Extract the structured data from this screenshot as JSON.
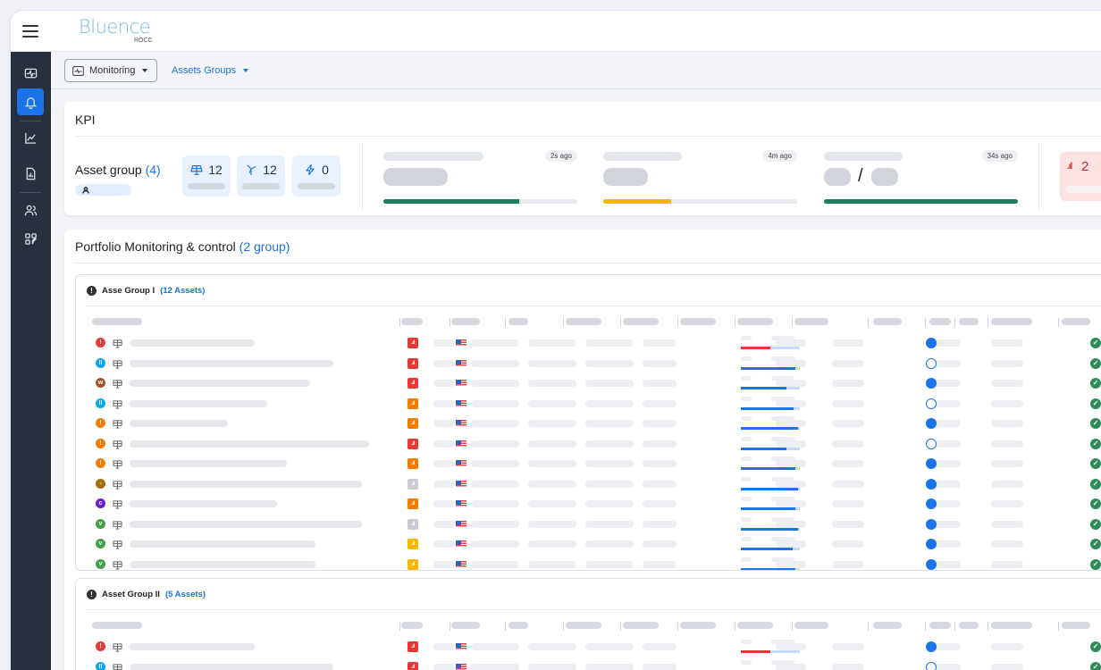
{
  "app": {
    "logo_text": "Bluence",
    "logo_sub": "ROCC"
  },
  "subheader": {
    "monitoring_label": "Monitoring",
    "asset_groups_label": "Assets Groups"
  },
  "sidebar": {
    "items": [
      {
        "icon": "pulse-monitor-icon",
        "active": false
      },
      {
        "icon": "bell-icon",
        "active": true
      },
      {
        "icon": "chart-trend-icon",
        "active": false
      },
      {
        "icon": "report-document-icon",
        "active": false
      },
      {
        "icon": "users-icon",
        "active": false
      },
      {
        "icon": "settings-grid-icon",
        "active": false
      }
    ]
  },
  "kpi": {
    "title": "KPI",
    "asset_group_label": "Asset group",
    "asset_group_count": "(4)",
    "stats": [
      {
        "icon": "solar-panel-icon",
        "value": "12"
      },
      {
        "icon": "wind-turbine-icon",
        "value": "12"
      },
      {
        "icon": "lightning-icon",
        "value": "0"
      }
    ],
    "metrics": [
      {
        "time": "2s ago",
        "progress": 0.7,
        "color": "#1b7f5a"
      },
      {
        "time": "4m ago",
        "progress": 0.35,
        "color": "#f4b400"
      },
      {
        "time": "34s ago",
        "progress": 1.0,
        "color": "#1b7f5a",
        "separator": "/"
      }
    ],
    "alert_value": "2"
  },
  "portfolio": {
    "title": "Portfolio Monitoring & control",
    "count": "(2 group)",
    "groups": [
      {
        "name": "Asse Group I",
        "count": "(12 Assets)",
        "rows": [
          {
            "status": "error",
            "status_color": "#e53935",
            "status_glyph": "!",
            "signal_color": "#e53935",
            "progress": 0.5,
            "progress_color": "#e53935",
            "online": true
          },
          {
            "status": "paused",
            "status_color": "#03a9f4",
            "status_glyph": "II",
            "signal_color": "#e53935",
            "progress": 0.92,
            "progress_color": "#1a73e8",
            "online": false
          },
          {
            "status": "maintenance",
            "status_color": "#a0522d",
            "status_glyph": "w",
            "signal_color": "#e53935",
            "progress": 0.78,
            "progress_color": "#1a73e8",
            "online": true
          },
          {
            "status": "paused",
            "status_color": "#03a9f4",
            "status_glyph": "II",
            "signal_color": "#f57c00",
            "progress": 0.9,
            "progress_color": "#1a73e8",
            "online": false
          },
          {
            "status": "warning",
            "status_color": "#f57c00",
            "status_glyph": "!",
            "signal_color": "#f57c00",
            "progress": 0.97,
            "progress_color": "#1a73e8",
            "online": true
          },
          {
            "status": "warning",
            "status_color": "#f57c00",
            "status_glyph": "!",
            "signal_color": "#e53935",
            "progress": 0.78,
            "progress_color": "#1a73e8",
            "online": false
          },
          {
            "status": "warning",
            "status_color": "#f57c00",
            "status_glyph": "!",
            "signal_color": "#f57c00",
            "progress": 0.93,
            "progress_color": "#1a73e8",
            "online": true
          },
          {
            "status": "stopped",
            "status_color": "#a0700d",
            "status_glyph": "-",
            "signal_color": "#c8ccd2",
            "progress": 0.97,
            "progress_color": "#1a73e8",
            "online": true
          },
          {
            "status": "night",
            "status_color": "#6a1bd6",
            "status_glyph": "c",
            "signal_color": "#f57c00",
            "progress": 0.93,
            "progress_color": "#1a73e8",
            "online": true
          },
          {
            "status": "ok",
            "status_color": "#43a047",
            "status_glyph": "v",
            "signal_color": "#c8ccd2",
            "progress": 0.97,
            "progress_color": "#1a73e8",
            "online": true
          },
          {
            "status": "ok",
            "status_color": "#43a047",
            "status_glyph": "v",
            "signal_color": "#f9b800",
            "progress": 0.88,
            "progress_color": "#1a73e8",
            "online": true
          },
          {
            "status": "ok",
            "status_color": "#43a047",
            "status_glyph": "v",
            "signal_color": "#f9b800",
            "progress": 0.93,
            "progress_color": "#1a73e8",
            "online": true
          }
        ]
      },
      {
        "name": "Asset Group II",
        "count": "(5 Assets)",
        "rows": [
          {
            "status": "error",
            "status_color": "#e53935",
            "status_glyph": "!",
            "signal_color": "#e53935",
            "progress": 0.5,
            "progress_color": "#e53935",
            "online": true
          },
          {
            "status": "paused",
            "status_color": "#03a9f4",
            "status_glyph": "II",
            "signal_color": "#e53935",
            "progress": 0.92,
            "progress_color": "#1a73e8",
            "online": false
          }
        ]
      }
    ]
  }
}
